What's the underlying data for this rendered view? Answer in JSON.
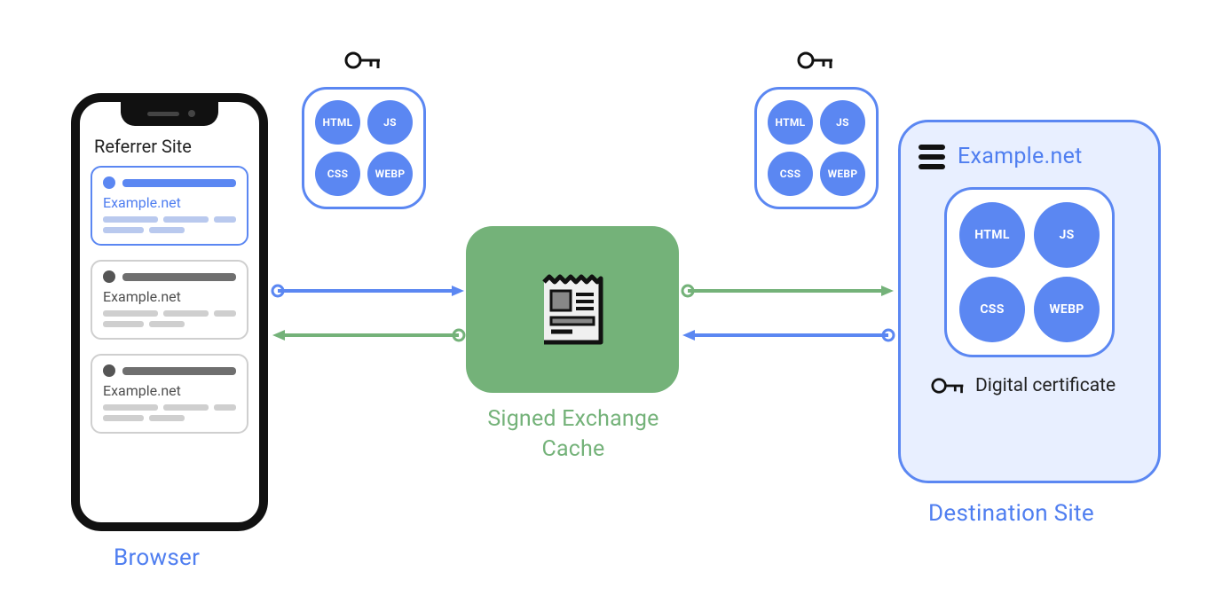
{
  "browser": {
    "label": "Browser",
    "referrer_title": "Referrer Site",
    "cards": [
      {
        "site": "Example.net",
        "active": true
      },
      {
        "site": "Example.net",
        "active": false
      },
      {
        "site": "Example.net",
        "active": false
      }
    ]
  },
  "assets": {
    "labels": [
      "HTML",
      "JS",
      "CSS",
      "WEBP"
    ]
  },
  "cache": {
    "label": "Signed Exchange Cache"
  },
  "destination": {
    "title": "Example.net",
    "certificate_label": "Digital certificate",
    "label": "Destination Site"
  },
  "colors": {
    "blue": "#5b87f2",
    "green": "#74b279"
  }
}
